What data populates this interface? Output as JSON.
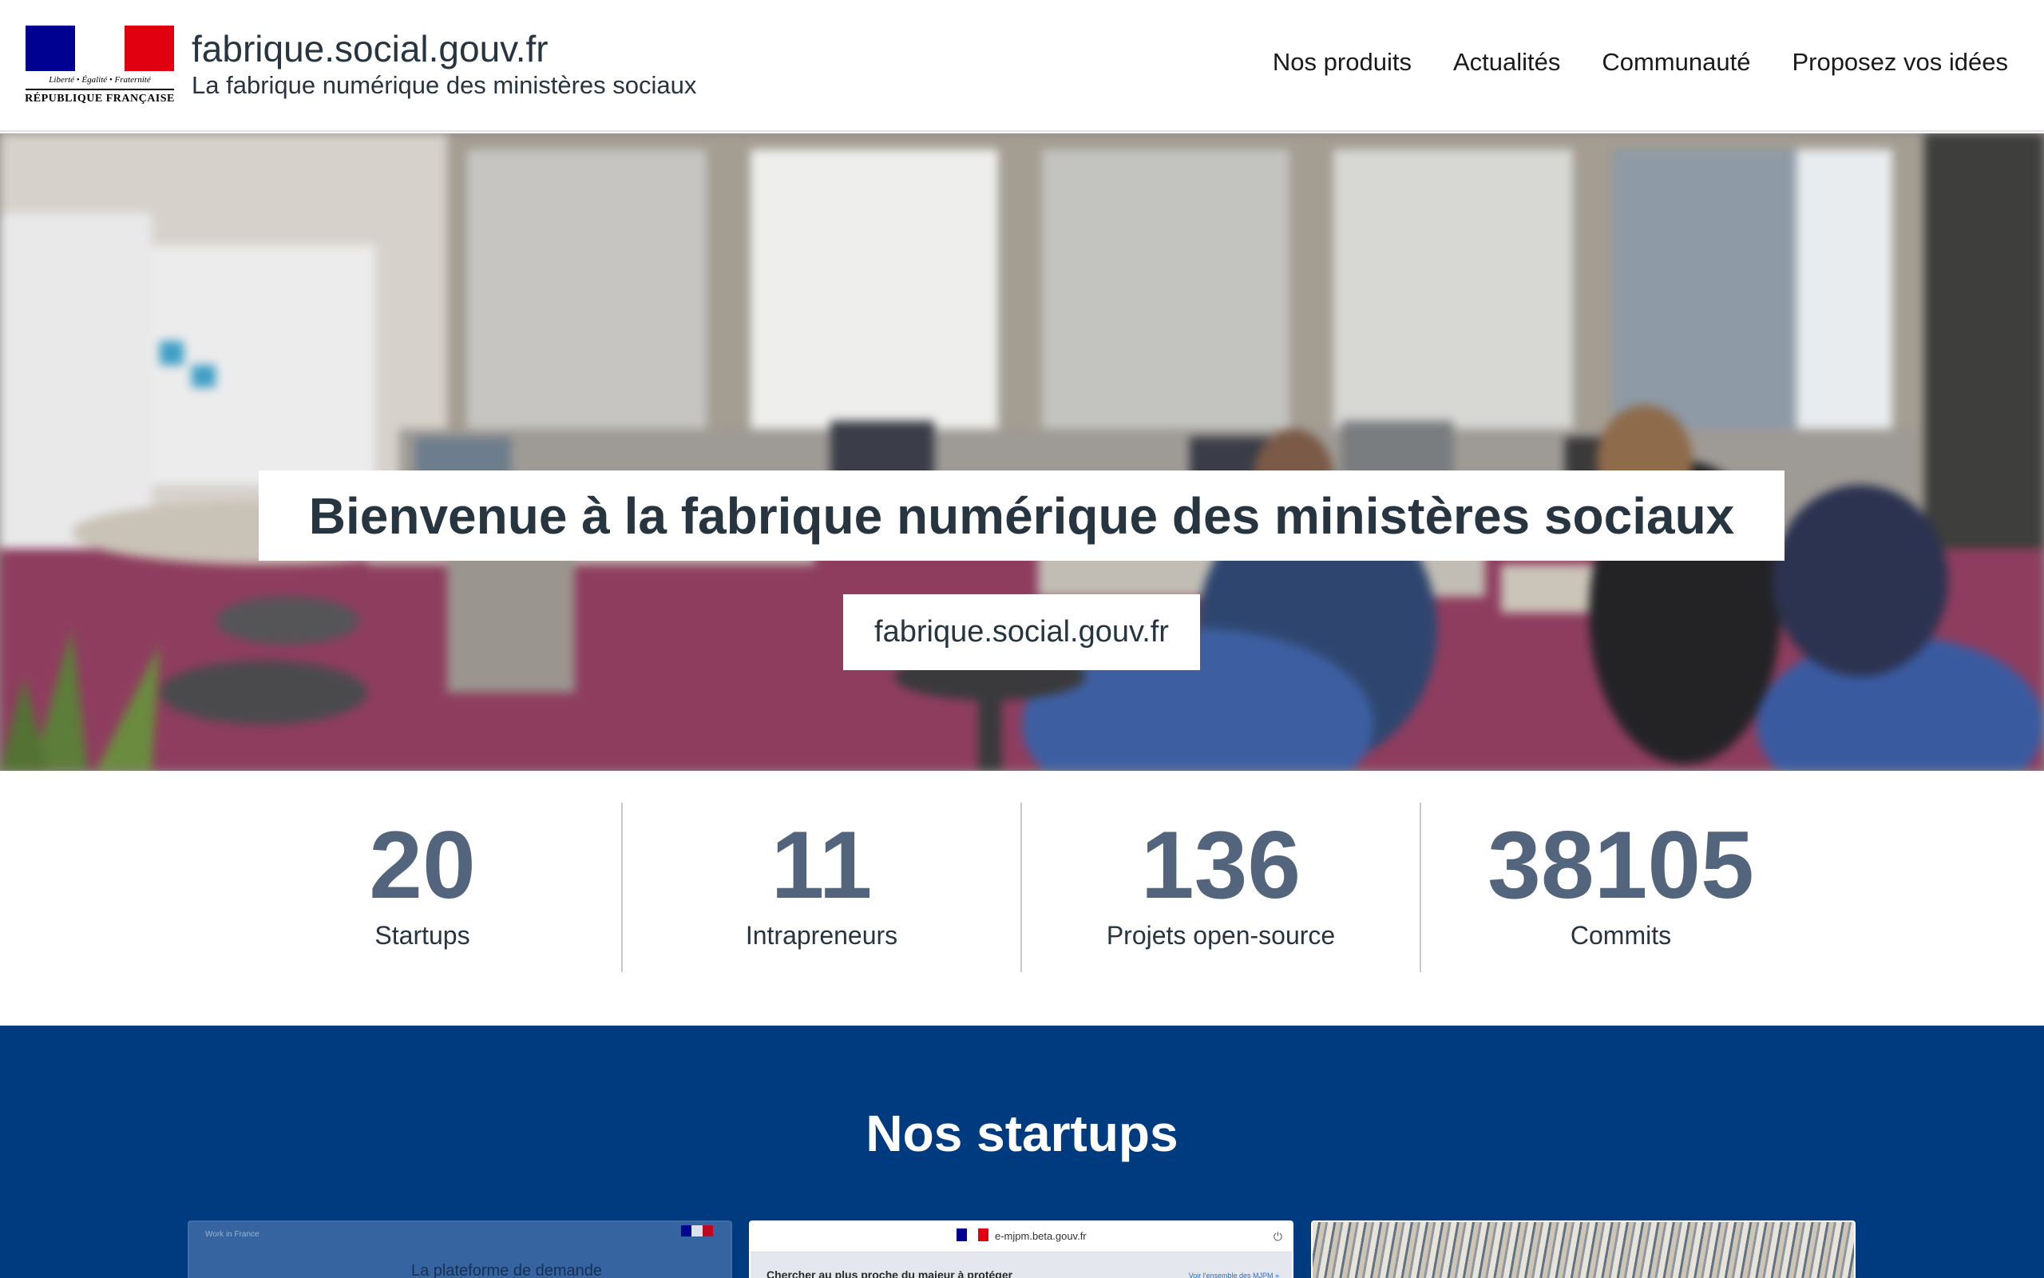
{
  "header": {
    "logo": {
      "motto": "Liberté • Égalité • Fraternité",
      "republic": "RÉPUBLIQUE FRANÇAISE",
      "colors": [
        "#000091",
        "#ffffff",
        "#e1000f"
      ]
    },
    "title": "fabrique.social.gouv.fr",
    "subtitle": "La fabrique numérique des ministères sociaux",
    "nav": [
      {
        "label": "Nos produits"
      },
      {
        "label": "Actualités"
      },
      {
        "label": "Communauté"
      },
      {
        "label": "Proposez vos idées"
      }
    ]
  },
  "hero": {
    "title": "Bienvenue à la fabrique numérique des ministères sociaux",
    "link_label": "fabrique.social.gouv.fr"
  },
  "stats": [
    {
      "value": "20",
      "label": "Startups"
    },
    {
      "value": "11",
      "label": "Intrapreneurs"
    },
    {
      "value": "136",
      "label": "Projets open-source"
    },
    {
      "value": "38105",
      "label": "Commits"
    }
  ],
  "startups": {
    "heading": "Nos startups",
    "cards": [
      {
        "top_text": "Work in France",
        "title": "La plateforme de demande"
      },
      {
        "url": "e-mjpm.beta.gouv.fr",
        "search": "Chercher au plus proche du majeur à protéger",
        "see_all": "Voir l'ensemble des MJPM »"
      },
      {}
    ]
  },
  "colors": {
    "primary_blue": "#003b80",
    "stat_number": "#53657d",
    "text_dark": "#26353f"
  }
}
